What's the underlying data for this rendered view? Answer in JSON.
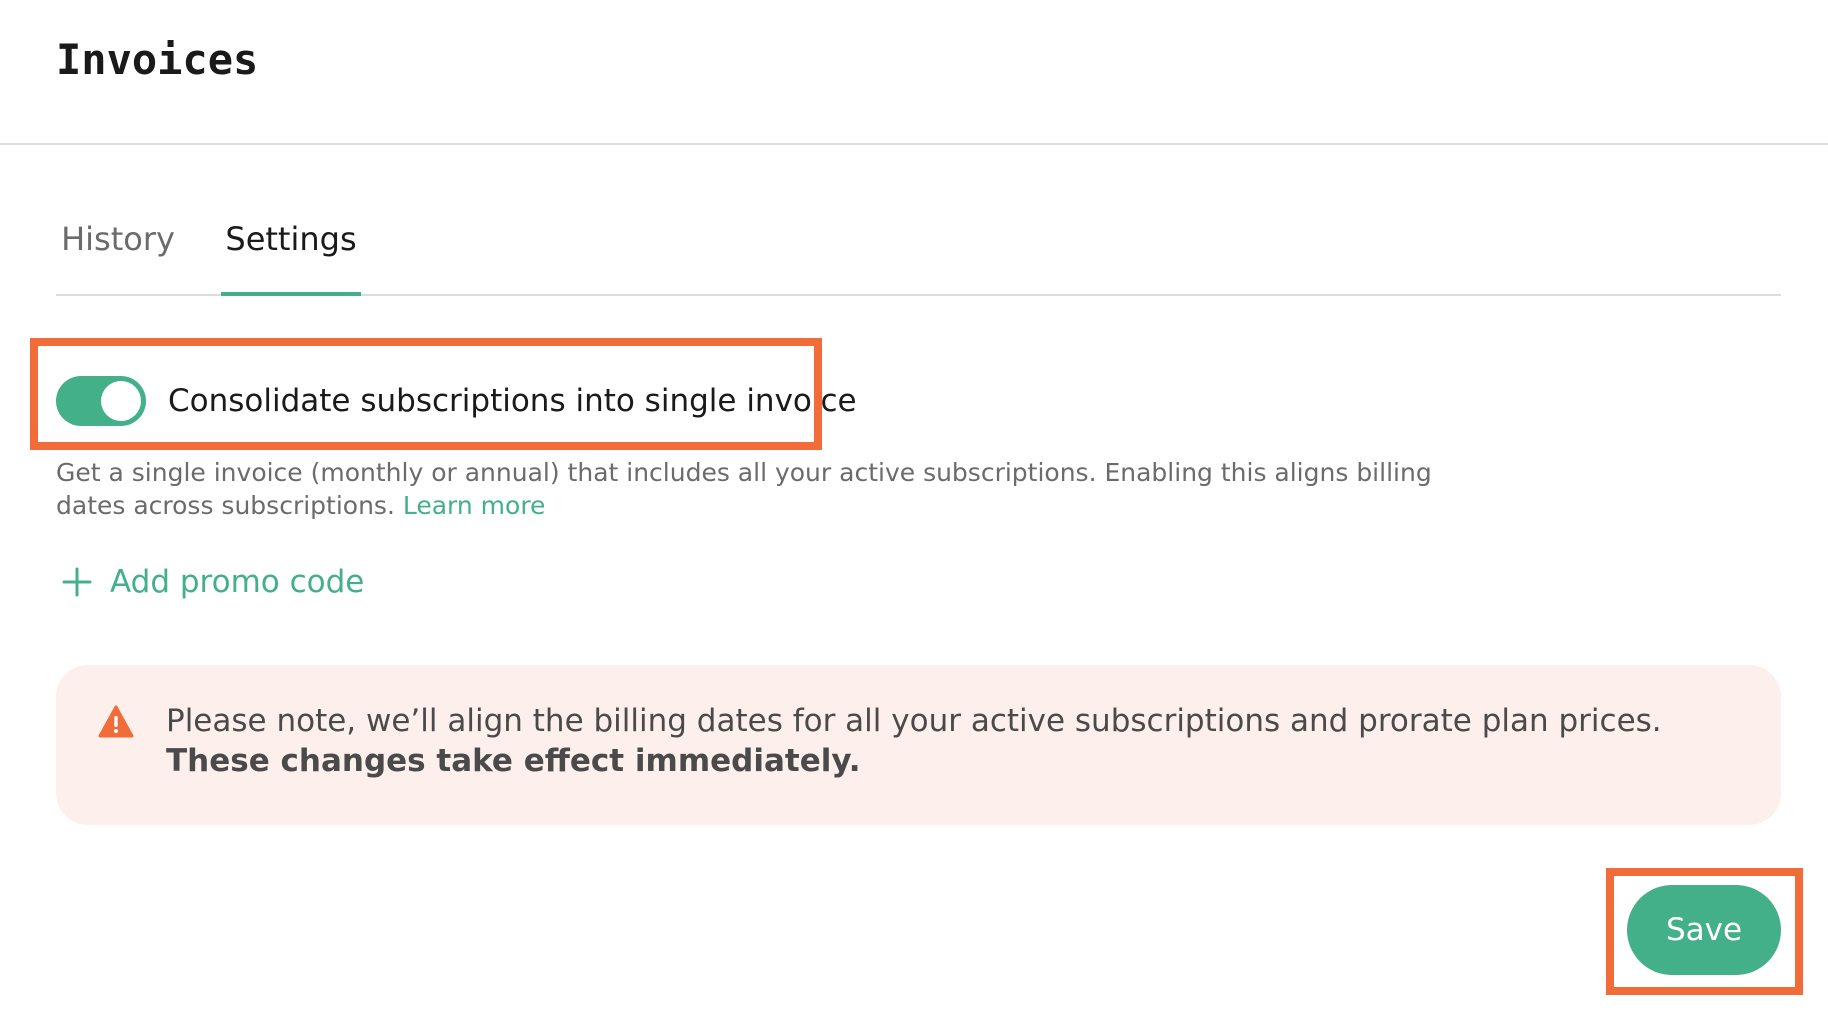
{
  "header": {
    "title": "Invoices"
  },
  "tabs": [
    {
      "label": "History",
      "active": false
    },
    {
      "label": "Settings",
      "active": true
    }
  ],
  "settings": {
    "consolidate_toggle": {
      "label": "Consolidate subscriptions into single invoice",
      "enabled": true
    },
    "description": "Get a single invoice (monthly or annual) that includes all your active subscriptions. Enabling this aligns billing dates across subscriptions.",
    "learn_more_label": "Learn more",
    "promo": {
      "icon": "plus-icon",
      "label": "Add promo code"
    },
    "notice": {
      "icon": "warning-icon",
      "text": "Please note, we’ll align the billing dates for all your active subscriptions and prorate plan prices.",
      "emphasis": "These changes take effect immediately."
    },
    "save_label": "Save"
  },
  "colors": {
    "accent": "#44b08a",
    "highlight": "#f26c3a",
    "notice_background": "#fdefeb",
    "warning": "#f26c3a"
  }
}
